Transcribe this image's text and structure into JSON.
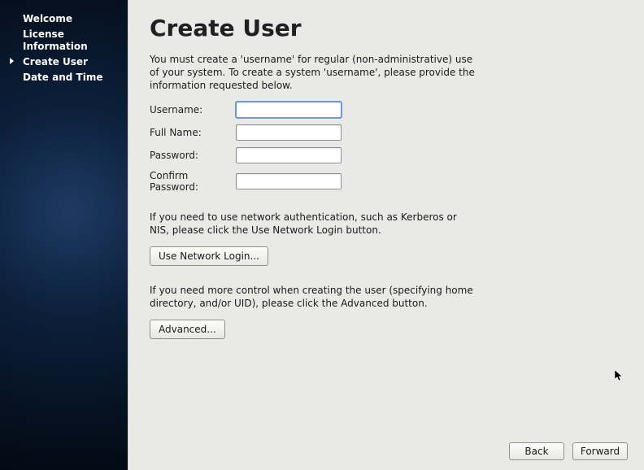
{
  "sidebar": {
    "items": [
      {
        "label": "Welcome"
      },
      {
        "label": "License Information"
      },
      {
        "label": "Create User"
      },
      {
        "label": "Date and Time"
      }
    ],
    "active_index": 2
  },
  "page": {
    "title": "Create User",
    "intro": "You must create a 'username' for regular (non-administrative) use of your system.  To create a system 'username', please provide the information requested below.",
    "network_text": "If you need to use network authentication, such as Kerberos or NIS, please click the Use Network Login button.",
    "advanced_text": "If you need more control when creating the user (specifying home directory, and/or UID), please click the Advanced button."
  },
  "form": {
    "username": {
      "label": "Username:",
      "value": ""
    },
    "fullname": {
      "label": "Full Name:",
      "value": ""
    },
    "password": {
      "label": "Password:",
      "value": ""
    },
    "confirm": {
      "label": "Confirm Password:",
      "value": ""
    }
  },
  "buttons": {
    "network_login": "Use Network Login...",
    "advanced": "Advanced...",
    "back": "Back",
    "forward": "Forward"
  }
}
